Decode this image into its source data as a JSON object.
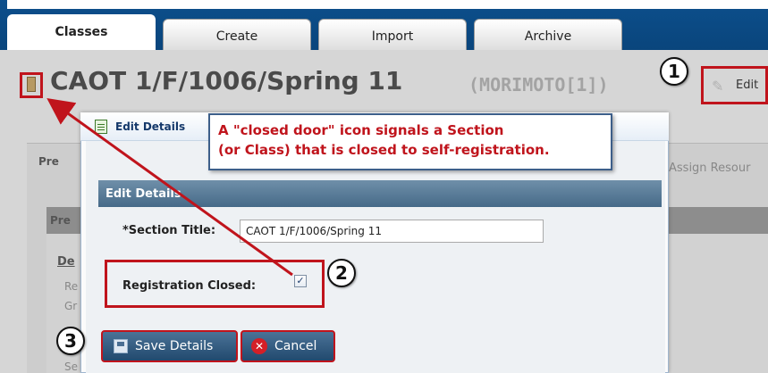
{
  "tabs": [
    {
      "label": "Classes",
      "active": true
    },
    {
      "label": "Create",
      "active": false
    },
    {
      "label": "Import",
      "active": false
    },
    {
      "label": "Archive",
      "active": false
    }
  ],
  "page": {
    "title": "CAOT 1/F/1006/Spring 11",
    "owner": "(MORIMOTO[1])",
    "edit_label": "Edit",
    "background_tab_fragment": "Pre",
    "background_assign_fragment": "Assign Resour",
    "background_panel_fragment": "Pre",
    "background_de": "De",
    "background_re": "Re",
    "background_gr": "Gr",
    "background_se": "Se"
  },
  "modal": {
    "title": "Edit Details",
    "section_heading": "Edit Details",
    "section_title_label": "*Section Title:",
    "section_title_value": "CAOT 1/F/1006/Spring 11",
    "registration_closed_label": "Registration Closed:",
    "registration_closed_checked": true,
    "save_label": "Save Details",
    "cancel_label": "Cancel"
  },
  "callout": {
    "line1": "A \"closed door\" icon signals a Section",
    "line2": "(or Class) that is closed to self-registration."
  },
  "markers": [
    "1",
    "2",
    "3"
  ],
  "icons": {
    "door": "closed-door-icon",
    "pencil": "pencil-icon",
    "doc": "document-icon",
    "save": "save-icon",
    "cancel": "cancel-x-icon"
  },
  "colors": {
    "tabbar": "#0c4f8c",
    "highlight": "#c0141c",
    "section_header": "#466a88",
    "button": "#21496e"
  }
}
